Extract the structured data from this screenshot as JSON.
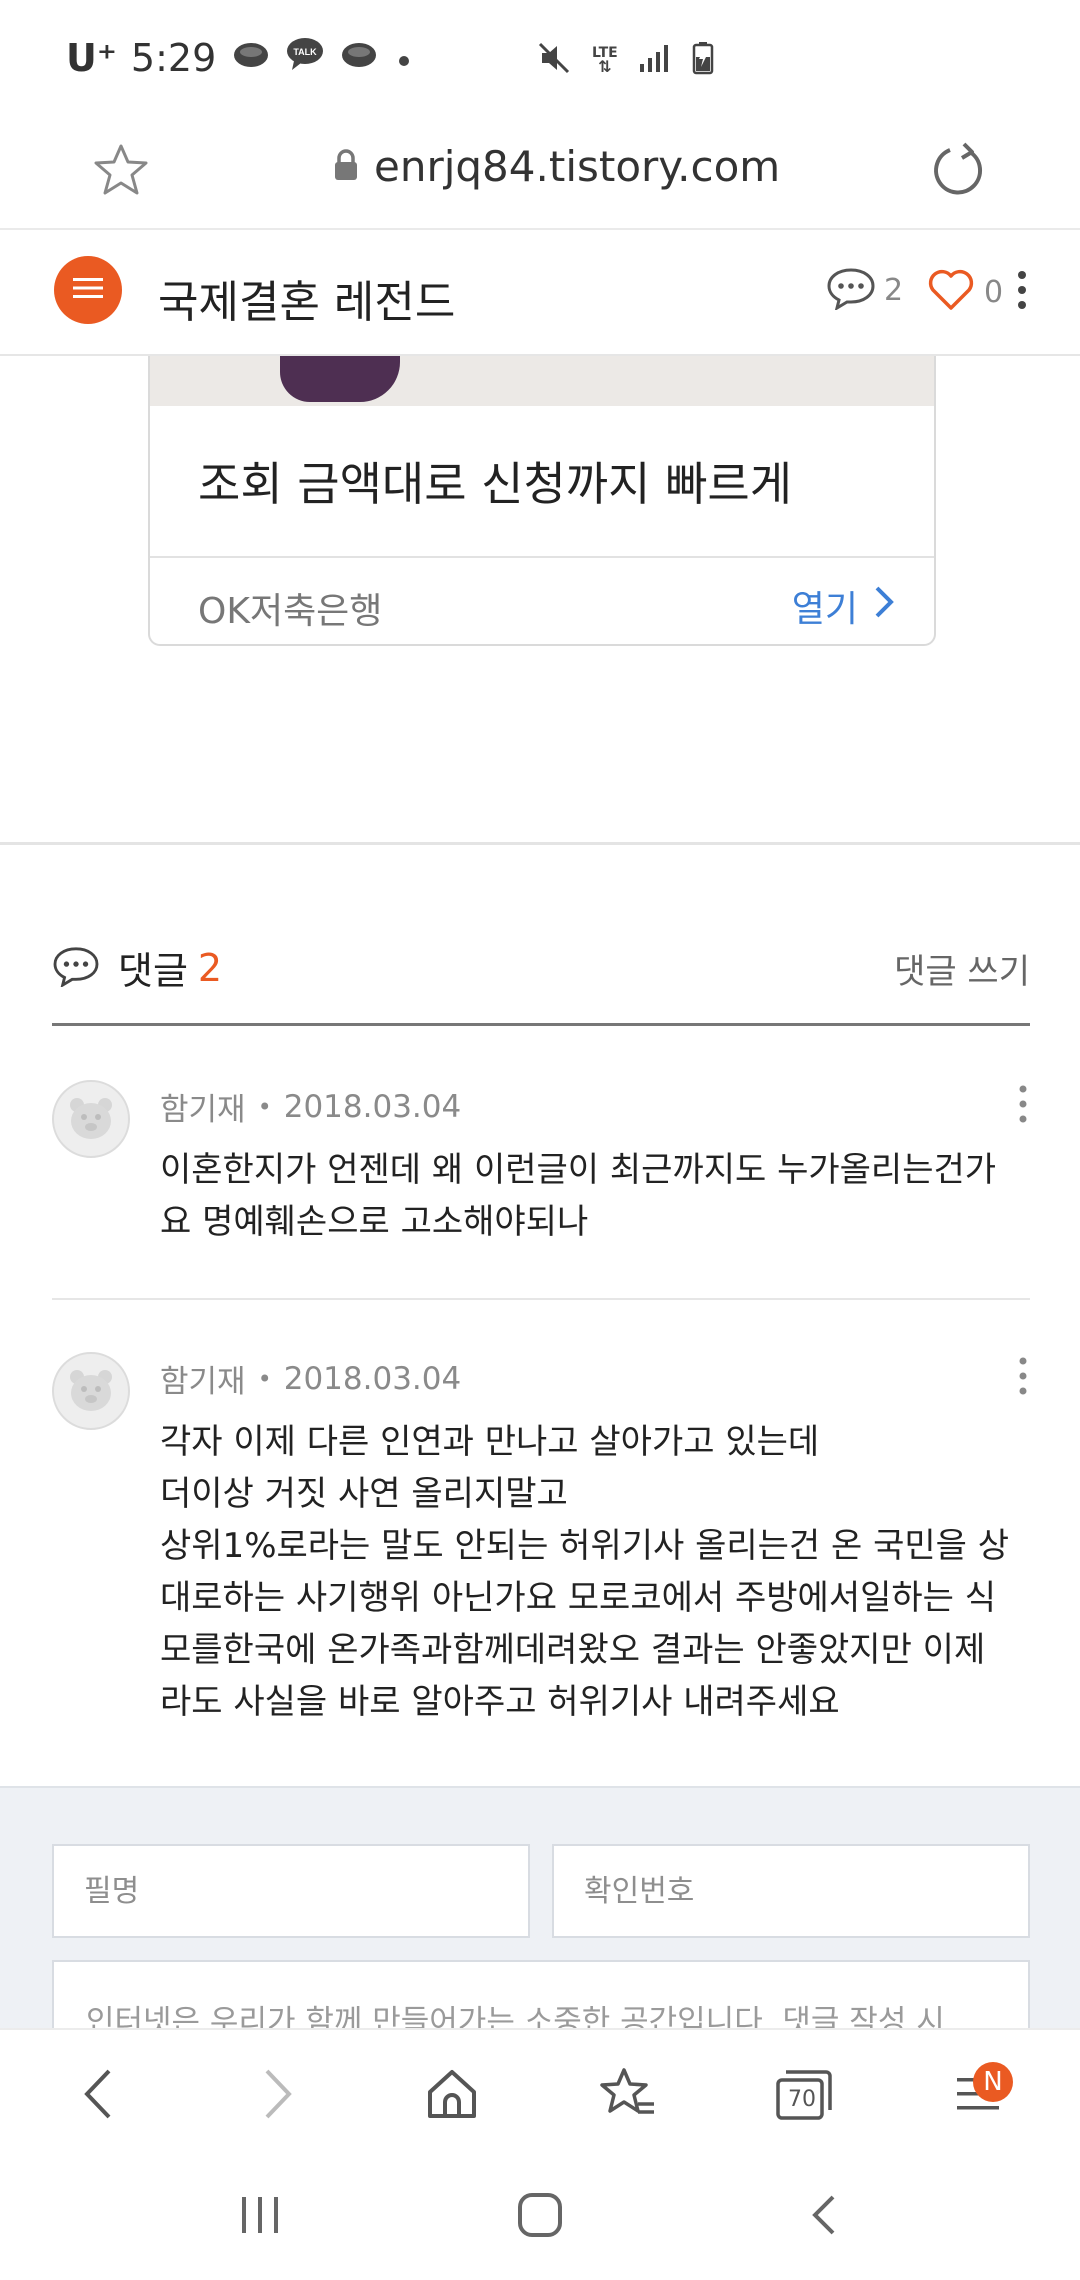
{
  "status_bar": {
    "carrier": "U⁺",
    "time": "5:29",
    "network": "LTE"
  },
  "url_bar": {
    "url": "enrjq84.tistory.com"
  },
  "blog_header": {
    "title": "국제결혼 레전드",
    "comment_count": "2",
    "like_count": "0"
  },
  "ad": {
    "headline": "조회 금액대로 신청까지 빠르게",
    "brand": "OK저축은행",
    "open_label": "열기"
  },
  "comments_section": {
    "label": "댓글",
    "count": "2",
    "write_label": "댓글 쓰기",
    "comments": [
      {
        "author": "함기재",
        "date": "2018.03.04",
        "lines": [
          "이혼한지가 언젠데 왜 이런글이 최근까지도 누가올리는건가",
          "요 명예훼손으로 고소해야되나"
        ]
      },
      {
        "author": "함기재",
        "date": "2018.03.04",
        "lines": [
          "각자 이제 다른 인연과 만나고 살아가고 있는데",
          "더이상 거짓 사연 올리지말고",
          "상위1%로라는 말도 안되는 허위기사 올리는건 온 국민을 상",
          "대로하는 사기행위 아닌가요 모로코에서 주방에서일하는 식",
          "모를한국에 온가족과함께데려왔오 결과는 안좋았지만 이제",
          "라도 사실을 바로 알아주고 허위기사 내려주세요"
        ]
      }
    ]
  },
  "form": {
    "name_placeholder": "필명",
    "password_placeholder": "확인번호",
    "comment_placeholder": "인터넷은 우리가 함께 만들어가는 소중한 공간입니다. 댓글 작성 시"
  },
  "toolbar": {
    "tab_count": "70",
    "menu_badge": "N"
  },
  "colors": {
    "accent": "#ea5a22",
    "link": "#3d7fd6",
    "form_bg": "#eef1f5"
  }
}
